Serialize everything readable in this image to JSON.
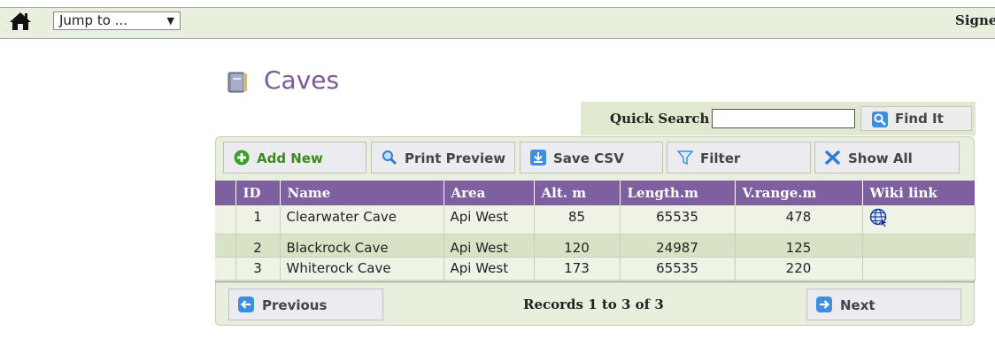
{
  "nav": {
    "jump_label": "Jump to ...",
    "jump_arrow": "▼",
    "signed": "Signe"
  },
  "page": {
    "title": "Caves"
  },
  "search": {
    "label": "Quick Search",
    "value": "",
    "button_label": "Find It"
  },
  "toolbar": {
    "add_new": "Add New",
    "print_preview": "Print Preview",
    "save_csv": "Save CSV",
    "filter": "Filter",
    "show_all": "Show All"
  },
  "table": {
    "columns": [
      "ID",
      "Name",
      "Area",
      "Alt. m",
      "Length.m",
      "V.range.m",
      "Wiki link"
    ],
    "rows": [
      {
        "id": "1",
        "name": "Clearwater Cave",
        "area": "Api West",
        "alt": "85",
        "length": "65535",
        "vrange": "478",
        "wiki": "globe-link-icon"
      },
      {
        "id": "2",
        "name": "Blackrock Cave",
        "area": "Api West",
        "alt": "120",
        "length": "24987",
        "vrange": "125",
        "wiki": ""
      },
      {
        "id": "3",
        "name": "Whiterock Cave",
        "area": "Api West",
        "alt": "173",
        "length": "65535",
        "vrange": "220",
        "wiki": ""
      }
    ]
  },
  "pager": {
    "previous": "Previous",
    "next": "Next",
    "records": "Records 1 to 3 of 3"
  },
  "colors": {
    "header_purple": "#7e5f9f",
    "title_purple": "#7a5a9c",
    "panel_green": "#e8efdc",
    "row_alt": "#d8e3c5"
  }
}
